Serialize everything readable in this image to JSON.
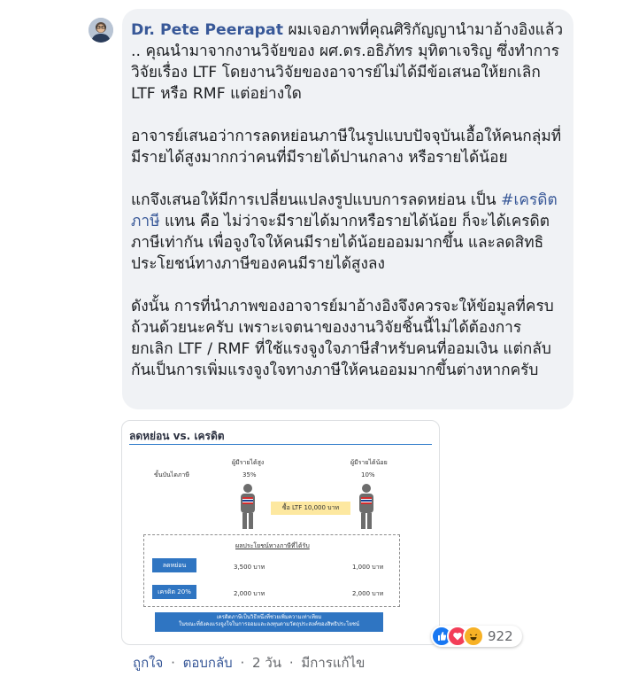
{
  "comment": {
    "author": "Dr. Pete Peerapat",
    "paragraphs": [
      "ผมเจอภาพที่คุณศิริกัญญานำมาอ้างอิงแล้ว .. คุณนำมาจากงานวิจัยของ ผศ.ดร.อธิภัทร มุทิตาเจริญ ซึ่งทำการวิจัยเรื่อง LTF โดยงานวิจัยของอาจารย์ไม่ได้มีข้อเสนอให้ยกเลิก LTF หรือ RMF แต่อย่างใด",
      "อาจารย์เสนอว่าการลดหย่อนภาษีในรูปแบบปัจจุบันเอื้อให้คนกลุ่มที่มีรายได้สูงมากกว่าคนที่มีรายได้ปานกลาง หรือรายได้น้อย",
      "ดังนั้น การที่นำภาพของอาจารย์มาอ้างอิงจึงควรจะให้ข้อมูลที่ครบถ้วนด้วยนะครับ เพราะเจตนาของงานวิจัยชิ้นนี้ไม่ได้ต้องการ ยกเลิก LTF / RMF ที่ใช้แรงจูงใจภาษีสำหรับคนที่ออมเงิน แต่กลับกันเป็นการเพิ่มแรงจูงใจทางภาษีให้คนออมมากขึ้นต่างหากครับ"
    ],
    "para3": {
      "before": "แกจึงเสนอให้มีการเปลี่ยนแปลงรูปแบบการลดหย่อน เป็น",
      "hashtag": "#เครดิตภาษี",
      "after": " แทน คือ ไม่ว่าจะมีรายได้มากหรือรายได้น้อย ก็จะได้เครดิตภาษีเท่ากัน เพื่อจูงใจให้คนมีรายได้น้อยออมมากขึ้น และลดสิทธิประโยชน์ทางภาษีของคนมีรายได้สูงลง"
    }
  },
  "infographic": {
    "title": "ลดหย่อน vs. เครดิต",
    "bracket_label": "ขั้นบันไดภาษี",
    "high_income_label": "ผู้มีรายได้สูง",
    "low_income_label": "ผู้มีรายได้น้อย",
    "high_rate": "35%",
    "low_rate": "10%",
    "buy_label": "ซื้อ LTF 10,000 บาท",
    "benefit_header": "ผลประโยชน์ทางภาษีที่ได้รับ",
    "rows": [
      {
        "label": "ลดหย่อน",
        "high": "3,500 บาท",
        "low": "1,000 บาท"
      },
      {
        "label": "เครดิต 20%",
        "high": "2,000 บาท",
        "low": "2,000 บาท"
      }
    ],
    "banner_line1": "เครดิตภาษีเป็นวิธีหนึ่งที่ช่วยเพิ่มความเท่าเทียม",
    "banner_line2": "ในขณะที่ยังคงแรงจูงใจในการออมและลงทุนตามวัตถุประสงค์ของสิทธิประโยชน์"
  },
  "reactions": {
    "count": "922",
    "icons": [
      "like-icon",
      "love-icon",
      "haha-icon"
    ],
    "colors": {
      "like": "#1877f2",
      "love": "#f33e58",
      "haha": "#f7b125"
    }
  },
  "actions": {
    "like": "ถูกใจ",
    "reply": "ตอบกลับ",
    "time": "2 วัน",
    "edited": "มีการแก้ไข",
    "separator": "·"
  },
  "colors": {
    "link": "#385898",
    "bubble": "#f0f2f5",
    "accent": "#2f75c2"
  }
}
